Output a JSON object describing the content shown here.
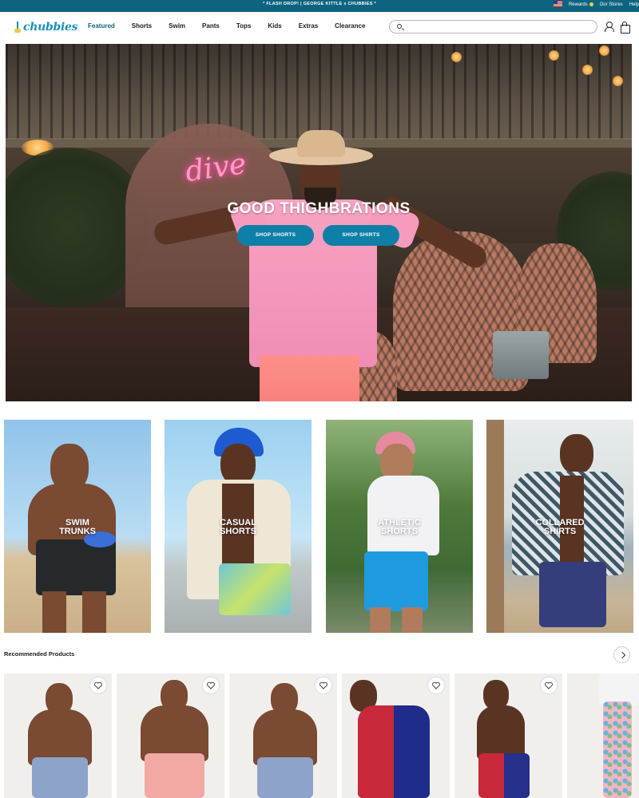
{
  "announcement": {
    "promo": "* FLASH DROP! | GEORGE KITTLE x CHUBBIES *",
    "rewards": "Rewards",
    "stores": "Our Stores",
    "help": "Help"
  },
  "nav": {
    "logo": "chubbies",
    "items": [
      "Featured",
      "Shorts",
      "Swim",
      "Pants",
      "Tops",
      "Kids",
      "Extras",
      "Clearance"
    ],
    "active": "Featured",
    "search_placeholder": ""
  },
  "hero": {
    "neon_sign": "dive",
    "headline": "GOOD THIGHBRATIONS",
    "buttons": [
      "SHOP SHORTS",
      "SHOP SHIRTS"
    ]
  },
  "categories": [
    {
      "label": "SWIM\nTRUNKS"
    },
    {
      "label": "CASUAL\nSHORTS"
    },
    {
      "label": "ATHLETIC\nSHORTS"
    },
    {
      "label": "COLLARED\nSHIRTS"
    }
  ],
  "recommended": {
    "title": "Recommended Products",
    "products": [
      {
        "shorts_color": "#8ea3c9"
      },
      {
        "shorts_color": "#f2a9a3"
      },
      {
        "shorts_color": "#8ea3c9"
      },
      {
        "shorts_color": "#1f2c8a"
      },
      {
        "shorts_color": "#c8283a"
      },
      {
        "shorts_color": "#f0b6c3"
      }
    ]
  },
  "colors": {
    "brand_blue": "#0e7fa7",
    "topbar": "#0d6480",
    "logo": "#1a8fb8"
  },
  "icons": [
    "search-icon",
    "account-icon",
    "bag-icon",
    "heart-icon",
    "chevron-right-icon",
    "flag-icon"
  ]
}
